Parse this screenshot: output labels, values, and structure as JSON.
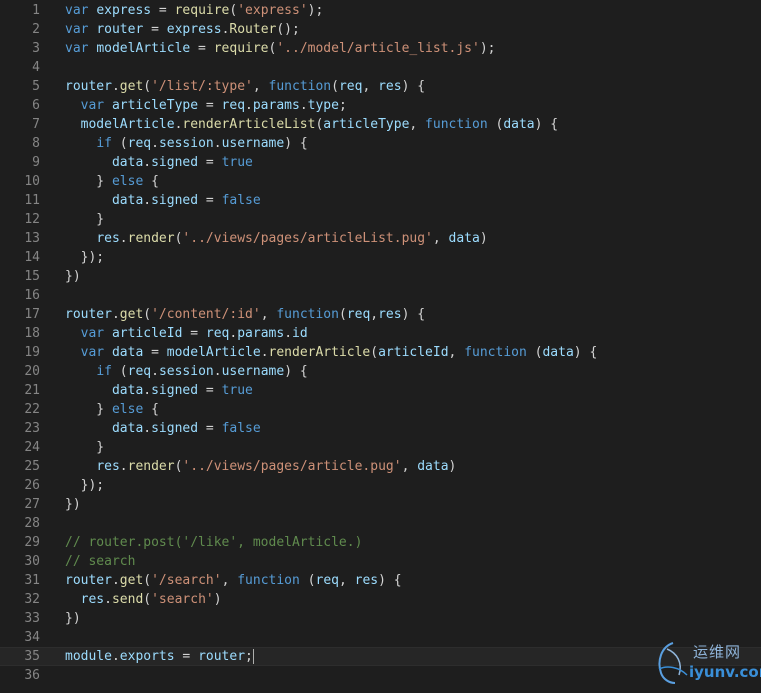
{
  "watermark": {
    "chinese": "运维网",
    "domain": "iyunv.com"
  },
  "colors": {
    "background": "#1e1e1e",
    "keyword": "#569cd6",
    "string": "#ce9178",
    "function": "#dcdcaa",
    "variable": "#9cdcfe",
    "type": "#4ec9b0",
    "comment": "#608b4e",
    "plain": "#d4d4d4",
    "line_number": "#858585"
  },
  "editor": {
    "current_line": 35,
    "lines": [
      {
        "n": "1",
        "tokens": [
          [
            "kw",
            "var"
          ],
          [
            "pl",
            " "
          ],
          [
            "var",
            "express"
          ],
          [
            "pl",
            " = "
          ],
          [
            "fn",
            "require"
          ],
          [
            "pl",
            "("
          ],
          [
            "str",
            "'express'"
          ],
          [
            "pl",
            ");"
          ]
        ]
      },
      {
        "n": "2",
        "tokens": [
          [
            "kw",
            "var"
          ],
          [
            "pl",
            " "
          ],
          [
            "var",
            "router"
          ],
          [
            "pl",
            " = "
          ],
          [
            "var",
            "express"
          ],
          [
            "pl",
            "."
          ],
          [
            "fn",
            "Router"
          ],
          [
            "pl",
            "();"
          ]
        ]
      },
      {
        "n": "3",
        "tokens": [
          [
            "kw",
            "var"
          ],
          [
            "pl",
            " "
          ],
          [
            "var",
            "modelArticle"
          ],
          [
            "pl",
            " = "
          ],
          [
            "fn",
            "require"
          ],
          [
            "pl",
            "("
          ],
          [
            "str",
            "'../model/article_list.js'"
          ],
          [
            "pl",
            ");"
          ]
        ]
      },
      {
        "n": "4",
        "tokens": []
      },
      {
        "n": "5",
        "tokens": [
          [
            "var",
            "router"
          ],
          [
            "pl",
            "."
          ],
          [
            "fn",
            "get"
          ],
          [
            "pl",
            "("
          ],
          [
            "str",
            "'/list/:type'"
          ],
          [
            "pl",
            ", "
          ],
          [
            "kw",
            "function"
          ],
          [
            "pl",
            "("
          ],
          [
            "var",
            "req"
          ],
          [
            "pl",
            ", "
          ],
          [
            "var",
            "res"
          ],
          [
            "pl",
            ") {"
          ]
        ]
      },
      {
        "n": "6",
        "tokens": [
          [
            "pl",
            "  "
          ],
          [
            "kw",
            "var"
          ],
          [
            "pl",
            " "
          ],
          [
            "var",
            "articleType"
          ],
          [
            "pl",
            " = "
          ],
          [
            "var",
            "req"
          ],
          [
            "pl",
            "."
          ],
          [
            "var",
            "params"
          ],
          [
            "pl",
            "."
          ],
          [
            "var",
            "type"
          ],
          [
            "pl",
            ";"
          ]
        ]
      },
      {
        "n": "7",
        "tokens": [
          [
            "pl",
            "  "
          ],
          [
            "var",
            "modelArticle"
          ],
          [
            "pl",
            "."
          ],
          [
            "fn",
            "renderArticleList"
          ],
          [
            "pl",
            "("
          ],
          [
            "var",
            "articleType"
          ],
          [
            "pl",
            ", "
          ],
          [
            "kw",
            "function"
          ],
          [
            "pl",
            " ("
          ],
          [
            "var",
            "data"
          ],
          [
            "pl",
            ") {"
          ]
        ]
      },
      {
        "n": "8",
        "tokens": [
          [
            "pl",
            "    "
          ],
          [
            "kw",
            "if"
          ],
          [
            "pl",
            " ("
          ],
          [
            "var",
            "req"
          ],
          [
            "pl",
            "."
          ],
          [
            "var",
            "session"
          ],
          [
            "pl",
            "."
          ],
          [
            "var",
            "username"
          ],
          [
            "pl",
            ") {"
          ]
        ]
      },
      {
        "n": "9",
        "tokens": [
          [
            "pl",
            "      "
          ],
          [
            "var",
            "data"
          ],
          [
            "pl",
            "."
          ],
          [
            "var",
            "signed"
          ],
          [
            "pl",
            " = "
          ],
          [
            "kw",
            "true"
          ]
        ]
      },
      {
        "n": "10",
        "tokens": [
          [
            "pl",
            "    } "
          ],
          [
            "kw",
            "else"
          ],
          [
            "pl",
            " {"
          ]
        ]
      },
      {
        "n": "11",
        "tokens": [
          [
            "pl",
            "      "
          ],
          [
            "var",
            "data"
          ],
          [
            "pl",
            "."
          ],
          [
            "var",
            "signed"
          ],
          [
            "pl",
            " = "
          ],
          [
            "kw",
            "false"
          ]
        ]
      },
      {
        "n": "12",
        "tokens": [
          [
            "pl",
            "    }"
          ]
        ]
      },
      {
        "n": "13",
        "tokens": [
          [
            "pl",
            "    "
          ],
          [
            "var",
            "res"
          ],
          [
            "pl",
            "."
          ],
          [
            "fn",
            "render"
          ],
          [
            "pl",
            "("
          ],
          [
            "str",
            "'../views/pages/articleList.pug'"
          ],
          [
            "pl",
            ", "
          ],
          [
            "var",
            "data"
          ],
          [
            "pl",
            ")"
          ]
        ]
      },
      {
        "n": "14",
        "tokens": [
          [
            "pl",
            "  });"
          ]
        ]
      },
      {
        "n": "15",
        "tokens": [
          [
            "pl",
            "})"
          ]
        ]
      },
      {
        "n": "16",
        "tokens": []
      },
      {
        "n": "17",
        "tokens": [
          [
            "var",
            "router"
          ],
          [
            "pl",
            "."
          ],
          [
            "fn",
            "get"
          ],
          [
            "pl",
            "("
          ],
          [
            "str",
            "'/content/:id'"
          ],
          [
            "pl",
            ", "
          ],
          [
            "kw",
            "function"
          ],
          [
            "pl",
            "("
          ],
          [
            "var",
            "req"
          ],
          [
            "pl",
            ","
          ],
          [
            "var",
            "res"
          ],
          [
            "pl",
            ") {"
          ]
        ]
      },
      {
        "n": "18",
        "tokens": [
          [
            "pl",
            "  "
          ],
          [
            "kw",
            "var"
          ],
          [
            "pl",
            " "
          ],
          [
            "var",
            "articleId"
          ],
          [
            "pl",
            " = "
          ],
          [
            "var",
            "req"
          ],
          [
            "pl",
            "."
          ],
          [
            "var",
            "params"
          ],
          [
            "pl",
            "."
          ],
          [
            "var",
            "id"
          ]
        ]
      },
      {
        "n": "19",
        "tokens": [
          [
            "pl",
            "  "
          ],
          [
            "kw",
            "var"
          ],
          [
            "pl",
            " "
          ],
          [
            "var",
            "data"
          ],
          [
            "pl",
            " = "
          ],
          [
            "var",
            "modelArticle"
          ],
          [
            "pl",
            "."
          ],
          [
            "fn",
            "renderArticle"
          ],
          [
            "pl",
            "("
          ],
          [
            "var",
            "articleId"
          ],
          [
            "pl",
            ", "
          ],
          [
            "kw",
            "function"
          ],
          [
            "pl",
            " ("
          ],
          [
            "var",
            "data"
          ],
          [
            "pl",
            ") {"
          ]
        ]
      },
      {
        "n": "20",
        "tokens": [
          [
            "pl",
            "    "
          ],
          [
            "kw",
            "if"
          ],
          [
            "pl",
            " ("
          ],
          [
            "var",
            "req"
          ],
          [
            "pl",
            "."
          ],
          [
            "var",
            "session"
          ],
          [
            "pl",
            "."
          ],
          [
            "var",
            "username"
          ],
          [
            "pl",
            ") {"
          ]
        ]
      },
      {
        "n": "21",
        "tokens": [
          [
            "pl",
            "      "
          ],
          [
            "var",
            "data"
          ],
          [
            "pl",
            "."
          ],
          [
            "var",
            "signed"
          ],
          [
            "pl",
            " = "
          ],
          [
            "kw",
            "true"
          ]
        ]
      },
      {
        "n": "22",
        "tokens": [
          [
            "pl",
            "    } "
          ],
          [
            "kw",
            "else"
          ],
          [
            "pl",
            " {"
          ]
        ]
      },
      {
        "n": "23",
        "tokens": [
          [
            "pl",
            "      "
          ],
          [
            "var",
            "data"
          ],
          [
            "pl",
            "."
          ],
          [
            "var",
            "signed"
          ],
          [
            "pl",
            " = "
          ],
          [
            "kw",
            "false"
          ]
        ]
      },
      {
        "n": "24",
        "tokens": [
          [
            "pl",
            "    }"
          ]
        ]
      },
      {
        "n": "25",
        "tokens": [
          [
            "pl",
            "    "
          ],
          [
            "var",
            "res"
          ],
          [
            "pl",
            "."
          ],
          [
            "fn",
            "render"
          ],
          [
            "pl",
            "("
          ],
          [
            "str",
            "'../views/pages/article.pug'"
          ],
          [
            "pl",
            ", "
          ],
          [
            "var",
            "data"
          ],
          [
            "pl",
            ")"
          ]
        ]
      },
      {
        "n": "26",
        "tokens": [
          [
            "pl",
            "  });"
          ]
        ]
      },
      {
        "n": "27",
        "tokens": [
          [
            "pl",
            "})"
          ]
        ]
      },
      {
        "n": "28",
        "tokens": []
      },
      {
        "n": "29",
        "tokens": [
          [
            "cm",
            "// router.post('/like', modelArticle.)"
          ]
        ]
      },
      {
        "n": "30",
        "tokens": [
          [
            "cm",
            "// search"
          ]
        ]
      },
      {
        "n": "31",
        "tokens": [
          [
            "var",
            "router"
          ],
          [
            "pl",
            "."
          ],
          [
            "fn",
            "get"
          ],
          [
            "pl",
            "("
          ],
          [
            "str",
            "'/search'"
          ],
          [
            "pl",
            ", "
          ],
          [
            "kw",
            "function"
          ],
          [
            "pl",
            " ("
          ],
          [
            "var",
            "req"
          ],
          [
            "pl",
            ", "
          ],
          [
            "var",
            "res"
          ],
          [
            "pl",
            ") {"
          ]
        ]
      },
      {
        "n": "32",
        "tokens": [
          [
            "pl",
            "  "
          ],
          [
            "var",
            "res"
          ],
          [
            "pl",
            "."
          ],
          [
            "fn",
            "send"
          ],
          [
            "pl",
            "("
          ],
          [
            "str",
            "'search'"
          ],
          [
            "pl",
            ")"
          ]
        ]
      },
      {
        "n": "33",
        "tokens": [
          [
            "pl",
            "})"
          ]
        ]
      },
      {
        "n": "34",
        "tokens": []
      },
      {
        "n": "35",
        "tokens": [
          [
            "var",
            "module"
          ],
          [
            "pl",
            "."
          ],
          [
            "var",
            "exports"
          ],
          [
            "pl",
            " = "
          ],
          [
            "var",
            "router"
          ],
          [
            "pl",
            ";"
          ]
        ]
      },
      {
        "n": "36",
        "tokens": []
      }
    ]
  }
}
